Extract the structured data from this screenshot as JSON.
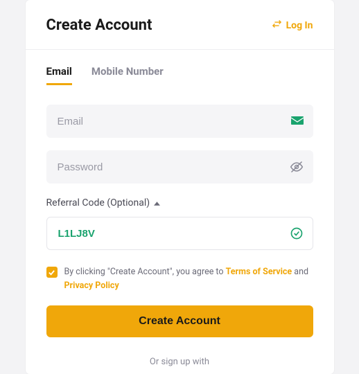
{
  "header": {
    "title": "Create Account",
    "login_label": "Log In"
  },
  "tabs": {
    "email": "Email",
    "mobile": "Mobile Number"
  },
  "fields": {
    "email_placeholder": "Email",
    "password_placeholder": "Password",
    "referral_label": "Referral Code (Optional)",
    "referral_value": "L1LJ8V"
  },
  "terms": {
    "prefix": "By clicking \"Create Account\", you agree to ",
    "tos": "Terms of Service",
    "mid": " and ",
    "privacy": "Privacy Policy"
  },
  "buttons": {
    "create": "Create Account"
  },
  "divider": "Or sign up with"
}
